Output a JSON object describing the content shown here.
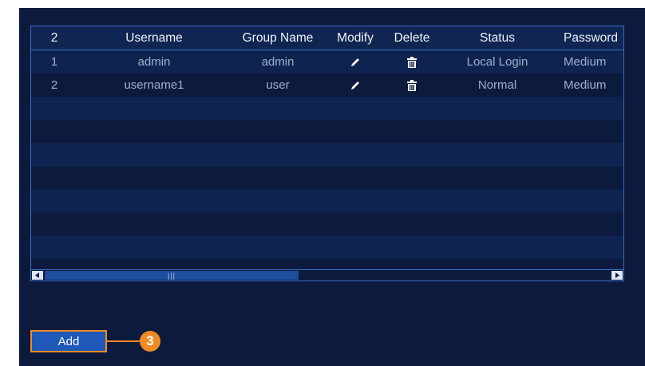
{
  "table": {
    "columns": [
      "2",
      "Username",
      "Group Name",
      "Modify",
      "Delete",
      "Status",
      "Password"
    ],
    "rows": [
      {
        "index": "1",
        "username": "admin",
        "group": "admin",
        "status": "Local Login",
        "password": "Medium"
      },
      {
        "index": "2",
        "username": "username1",
        "group": "user",
        "status": "Normal",
        "password": "Medium"
      }
    ]
  },
  "scrollbar": {
    "thumb_glyph": "|||"
  },
  "buttons": {
    "add_label": "Add"
  },
  "callout": {
    "number": "3"
  },
  "colors": {
    "panel": "#0c1b3d",
    "accent_border": "#3a6fc6",
    "button": "#1f58b8",
    "highlight": "#f08a24"
  },
  "icons": {
    "modify": "pencil-icon",
    "delete": "trash-icon"
  }
}
